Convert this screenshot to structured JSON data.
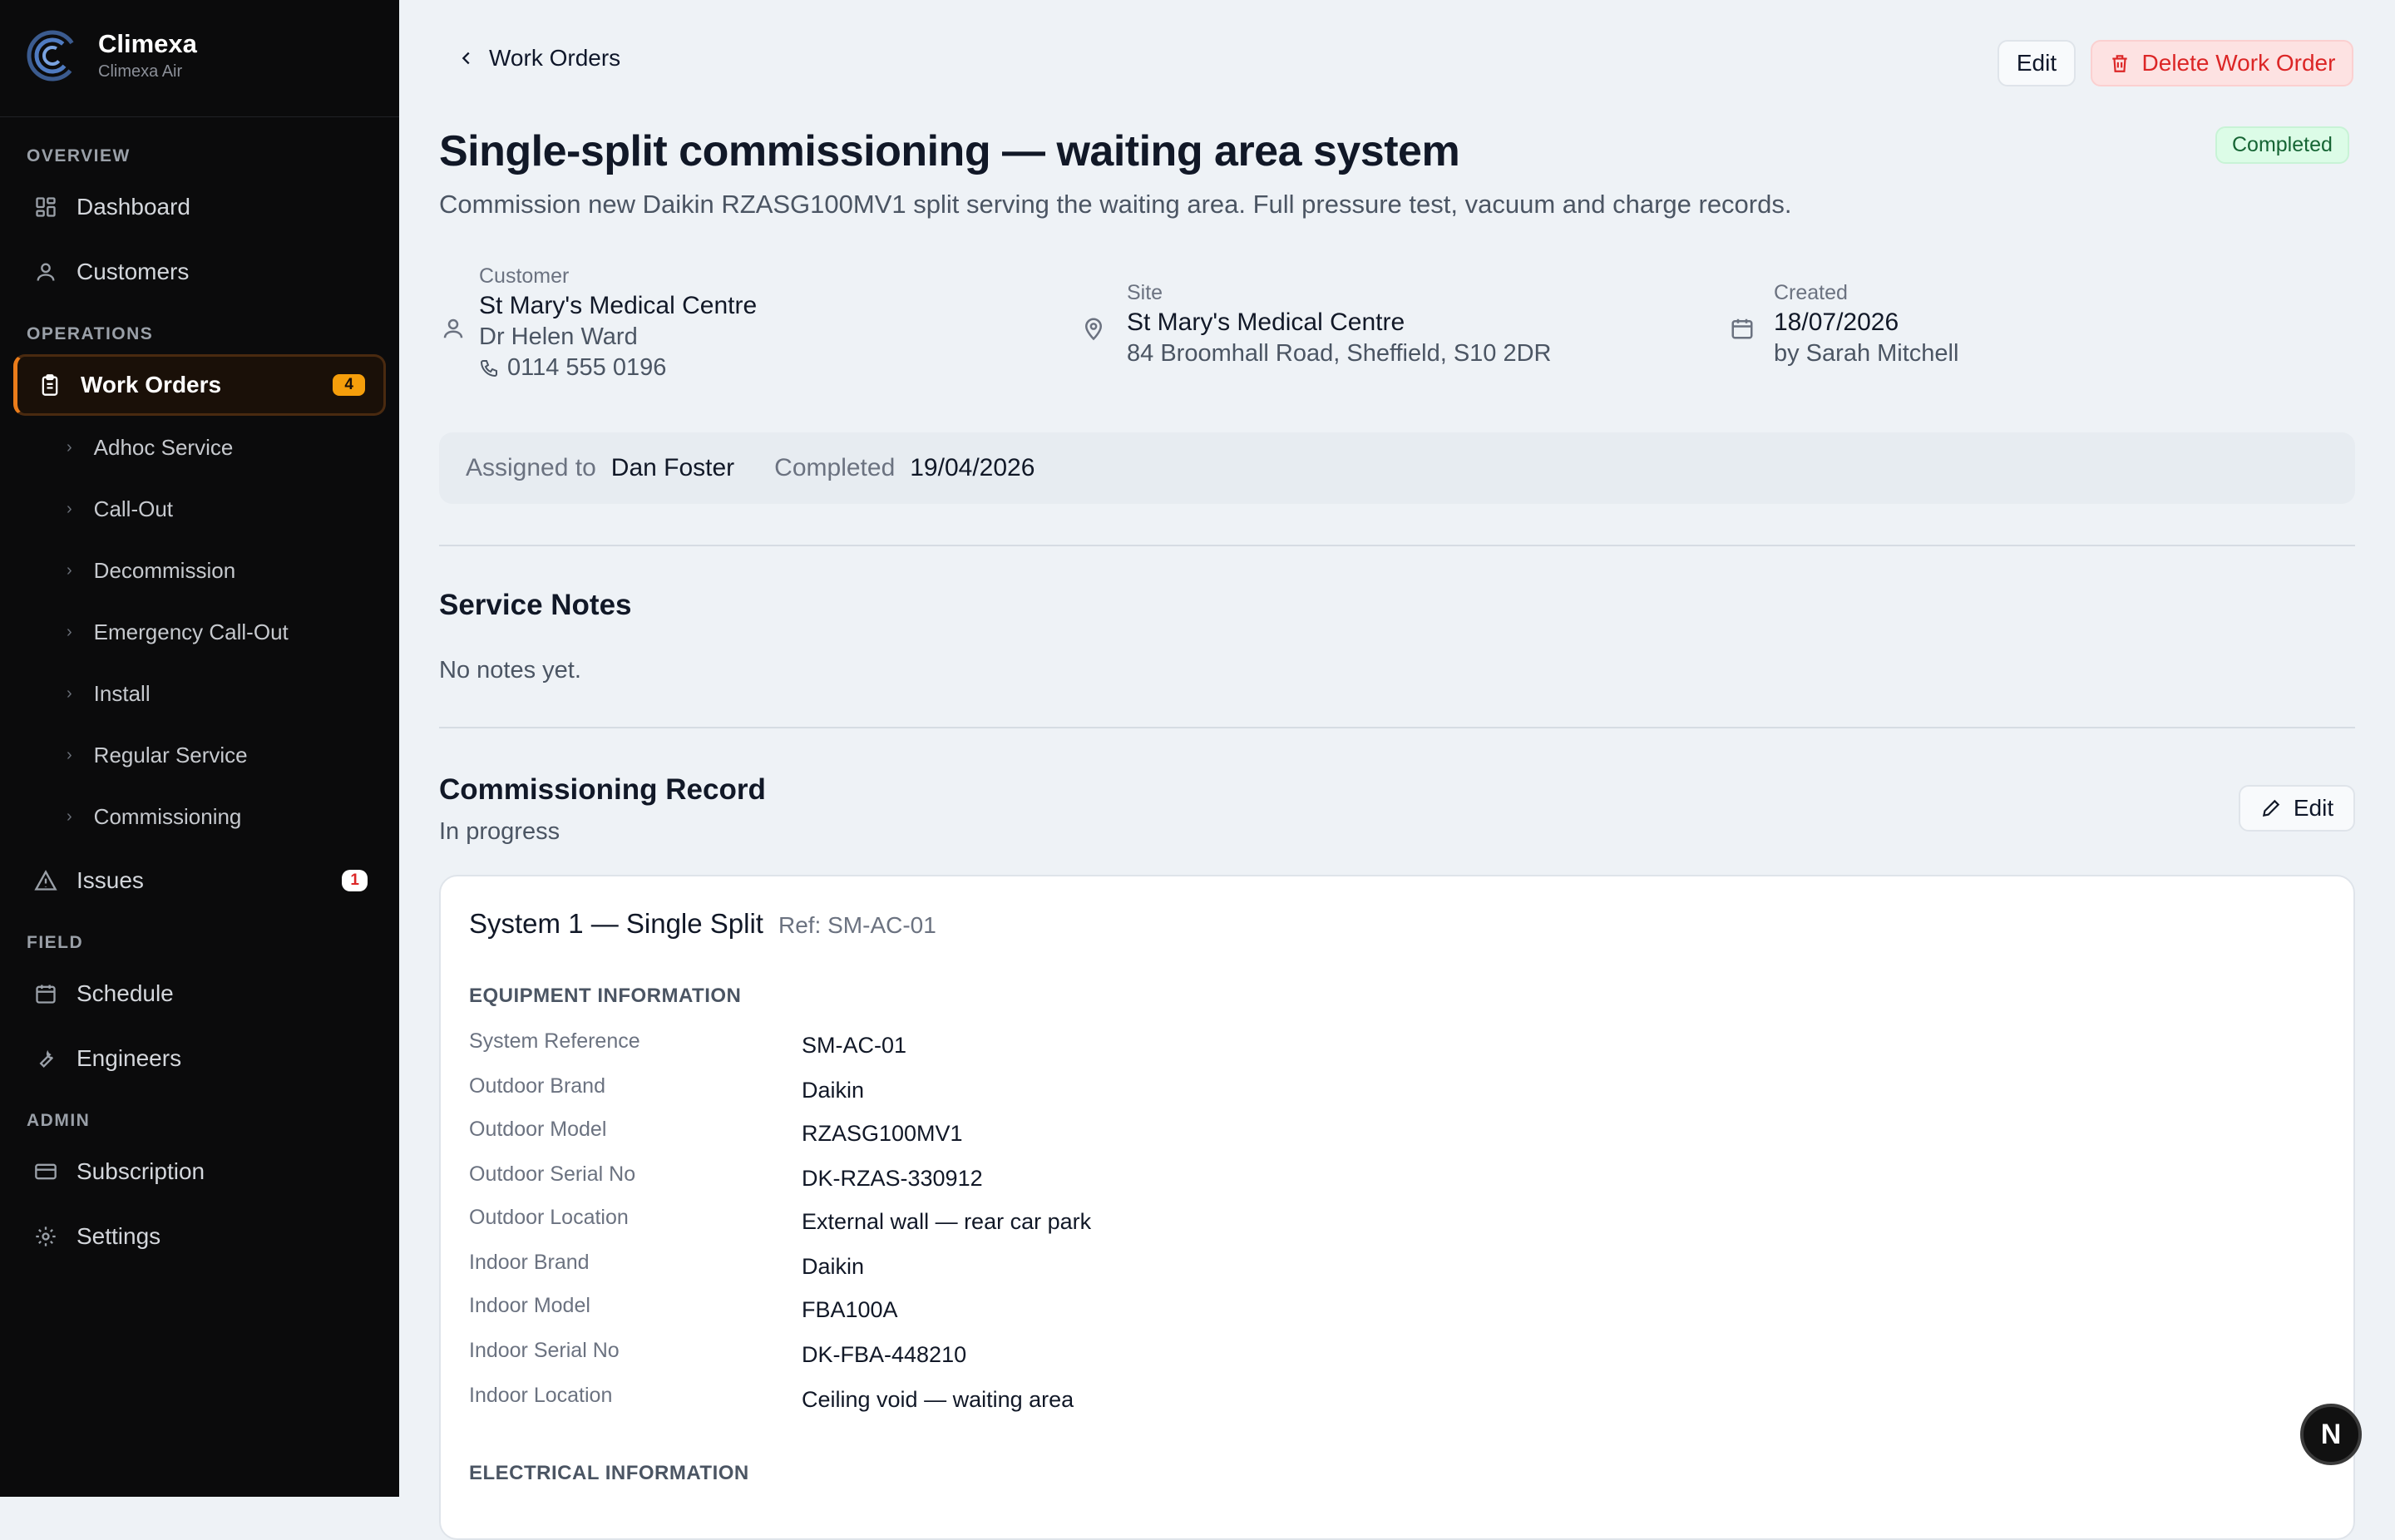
{
  "brand": {
    "name": "Climexa",
    "sub": "Climexa Air"
  },
  "sidebar": {
    "sections": {
      "overview": "OVERVIEW",
      "operations": "OPERATIONS",
      "field": "FIELD",
      "admin": "ADMIN"
    },
    "items": {
      "dashboard": "Dashboard",
      "customers": "Customers",
      "work_orders": "Work Orders",
      "work_orders_badge": "4",
      "issues": "Issues",
      "issues_badge": "1",
      "schedule": "Schedule",
      "engineers": "Engineers",
      "subscription": "Subscription",
      "settings": "Settings"
    },
    "sub_items": [
      "Adhoc Service",
      "Call-Out",
      "Decommission",
      "Emergency Call-Out",
      "Install",
      "Regular Service",
      "Commissioning"
    ]
  },
  "header": {
    "back_label": "Work Orders",
    "edit_label": "Edit",
    "delete_label": "Delete Work Order"
  },
  "work_order": {
    "title": "Single-split commissioning — waiting area system",
    "status": "Completed",
    "description": "Commission new Daikin RZASG100MV1 split serving the waiting area. Full pressure test, vacuum and charge records.",
    "customer": {
      "label": "Customer",
      "name": "St Mary's Medical Centre",
      "contact": "Dr Helen Ward",
      "phone": "0114 555 0196"
    },
    "site": {
      "label": "Site",
      "name": "St Mary's Medical Centre",
      "address": "84 Broomhall Road, Sheffield, S10 2DR"
    },
    "created": {
      "label": "Created",
      "date": "18/07/2026",
      "by": "by Sarah Mitchell"
    },
    "assigned_label": "Assigned to",
    "assigned_to": "Dan Foster",
    "completed_label": "Completed",
    "completed_date": "19/04/2026"
  },
  "service_notes": {
    "title": "Service Notes",
    "text": "No notes yet."
  },
  "commissioning": {
    "title": "Commissioning Record",
    "status": "In progress",
    "edit_label": "Edit",
    "system_title": "System 1 — Single Split",
    "system_ref": "Ref: SM-AC-01",
    "equipment_heading": "EQUIPMENT INFORMATION",
    "equipment": [
      {
        "label": "System Reference",
        "value": "SM-AC-01"
      },
      {
        "label": "Outdoor Brand",
        "value": "Daikin"
      },
      {
        "label": "Outdoor Model",
        "value": "RZASG100MV1"
      },
      {
        "label": "Outdoor Serial No",
        "value": "DK-RZAS-330912"
      },
      {
        "label": "Outdoor Location",
        "value": "External wall — rear car park"
      },
      {
        "label": "Indoor Brand",
        "value": "Daikin"
      },
      {
        "label": "Indoor Model",
        "value": "FBA100A"
      },
      {
        "label": "Indoor Serial No",
        "value": "DK-FBA-448210"
      },
      {
        "label": "Indoor Location",
        "value": "Ceiling void — waiting area"
      }
    ],
    "electrical_heading": "ELECTRICAL INFORMATION"
  },
  "floating_button": {
    "label": "N"
  },
  "colors": {
    "accent": "#ea7c1a",
    "danger": "#dc2626",
    "success": "#166534",
    "sidebar_bg": "#0b0b0c"
  }
}
